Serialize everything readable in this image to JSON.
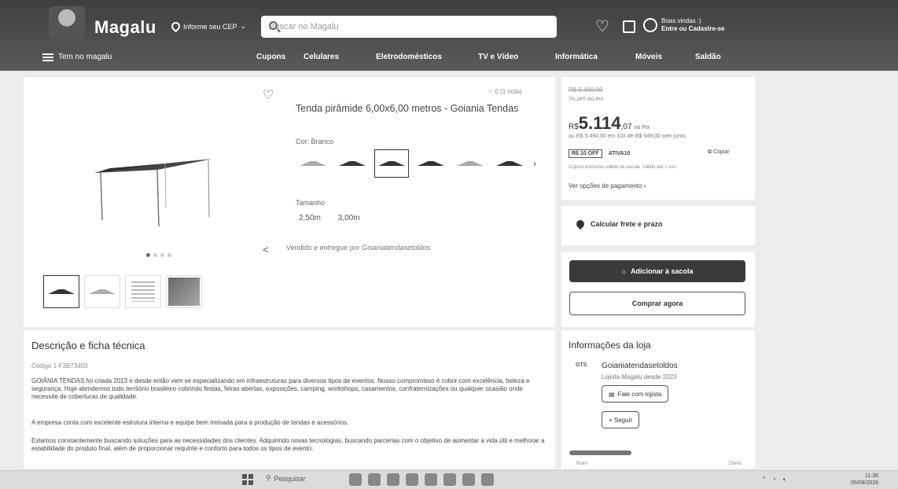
{
  "header": {
    "logo": "Magalu",
    "cep_label": "Informe seu CEP",
    "search_placeholder": "Buscar no Magalu",
    "user_greeting": "Boas vindas :)",
    "user_action": "Entre ou Cadastre-se",
    "menu_label": "Tem no magalu",
    "nav": [
      "Cupons",
      "Celulares",
      "Eletrodomésticos",
      "TV e Vídeo",
      "Informática",
      "Móveis",
      "Saldão"
    ]
  },
  "product": {
    "rating": "0 (1 nota)",
    "title": "Tenda pirâmide 6,00x6,00 metros - Goiania Tendas",
    "color_label": "Cor: Branco",
    "size_label": "Tamanho",
    "sizes": [
      "2,50m",
      "3,00m"
    ],
    "seller_line": "Vendido e entregue por Goianiatendasetoldos"
  },
  "pricing": {
    "old_price": "R$ 5.490,00",
    "discount_note": "7% OFF NO PIX",
    "currency": "R$",
    "price_main": "5.114",
    "price_cents": ",07",
    "price_pix": "no Pix",
    "installment": "ou R$ 5.490,00 em 10x de R$ 549,00 sem juros",
    "coupon_value": "R$ 10 OFF",
    "coupon_code": "ATIVA10",
    "copy_label": "Copiar",
    "coupon_note": "Cupom exclusivo válido na sacola. Válido até 1 uso",
    "payment_options": "Ver opções de pagamento",
    "shipping": "Calcular frete e prazo",
    "add_to_bag": "Adicionar à sacola",
    "buy_now": "Comprar agora"
  },
  "description": {
    "title": "Descrição e ficha técnica",
    "code": "Código 1-F3B73403",
    "p1": "GOIÂNIA TENDAS foi criada 2013 e desde então vem se especializando em infraestruturas para diversos tipos de eventos. Nosso compromisso é cobrir com excelência, beleza e segurança. Hoje atendemos todo território brasileiro cobrindo festas, feiras abertas, exposições, camping, workshops, casamentos, confraternizações ou qualquer ocasião onde necessite de coberturas de qualidade.",
    "p2": "A empresa conta com excelente estrutura interna e equipe bem treinada para a produção de tendas e acessórios.",
    "p3": "Estamos constantemente buscando soluções para as necessidades dos clientes. Adquirindo novas tecnologias, buscando parcerias com o objetivo de aumentar a vida útil e melhorar a estabilidade do produto final, além de proporcionar requinte e conforto para todos os tipos de evento."
  },
  "store": {
    "title": "Informações da loja",
    "logo_text": "GTS",
    "name": "Goianiatendasetoldos",
    "since": "Lojista Magalu desde 2023",
    "talk_label": "Fale com lojista",
    "follow_label": "+ Seguir",
    "rating_low": "Ruim",
    "rating_high": "Ótimo",
    "reputation_fraction": 0.35
  },
  "taskbar": {
    "search_label": "Pesquisar",
    "time": "11:36",
    "date": "05/09/2026"
  }
}
